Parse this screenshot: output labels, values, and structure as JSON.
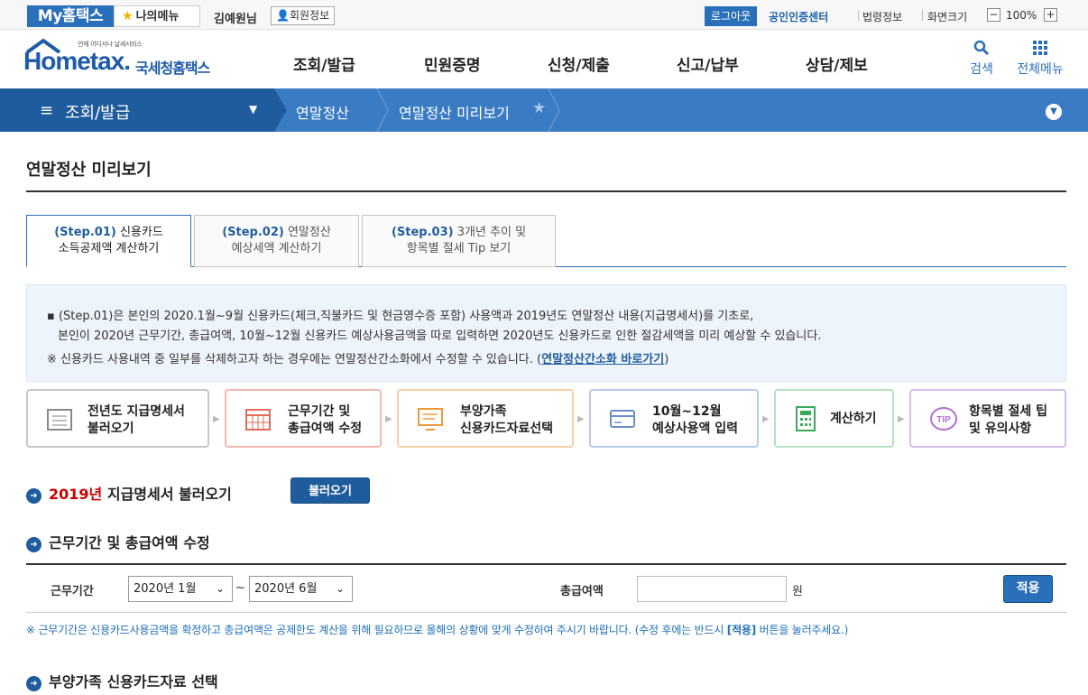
{
  "topbar": {
    "my_home": "My홈택스",
    "my_menu": "나의메뉴",
    "user_name": "김예원님",
    "member_info": "회원정보",
    "logout": "로그아웃",
    "cert_center": "공인인증센터",
    "law_info": "법령정보",
    "screen_size": "화면크기",
    "zoom": "100%"
  },
  "brand": {
    "tagline": "언제 어디서나 날세서비스",
    "word": "Hometax.",
    "sub": "국세청홈택스"
  },
  "nav": {
    "items": [
      "조회/발급",
      "민원증명",
      "신청/제출",
      "신고/납부",
      "상담/제보"
    ],
    "search": "검색",
    "all_menu": "전체메뉴"
  },
  "breadcrumb": {
    "root": "조회/발급",
    "level2": "연말정산",
    "level3": "연말정산 미리보기"
  },
  "page": {
    "title": "연말정산 미리보기"
  },
  "tabs": [
    {
      "step": "(Step.01)",
      "line1": "신용카드",
      "line2": "소득공제액 계산하기"
    },
    {
      "step": "(Step.02)",
      "line1": "연말정산",
      "line2": "예상세액 계산하기"
    },
    {
      "step": "(Step.03)",
      "line1": "3개년 추이 및",
      "line2": "항목별 절세 Tip 보기"
    }
  ],
  "notice": {
    "line1": "▪ (Step.01)은 본인의 2020.1월~9월 신용카드(체크,직불카드 및 현금영수증 포함) 사용액과 2019년도 연말정산 내용(지급명세서)를 기초로,",
    "line2": "본인이 2020년 근무기간, 총급여액, 10월~12월 신용카드 예상사용금액을 따로 입력하면 2020년도 신용카드로 인한 절감세액을 미리 예상할 수 있습니다.",
    "line3": "※ 신용카드 사용내역 중 일부를 삭제하고자 하는 경우에는 연말정산간소화에서 수정할 수 있습니다.",
    "link": "연말정산간소화 바로가기"
  },
  "flow": [
    {
      "line1": "전년도 지급명세서",
      "line2": "불러오기",
      "icon": "document-icon",
      "color": "#c8c8c8"
    },
    {
      "line1": "근무기간 및",
      "line2": "총급여액 수정",
      "icon": "calendar-icon",
      "color": "#f2b8b0"
    },
    {
      "line1": "부양가족",
      "line2": "신용카드자료선택",
      "icon": "monitor-icon",
      "color": "#f6d1a8"
    },
    {
      "line1": "10월~12월",
      "line2": "예상사용액 입력",
      "icon": "card-icon",
      "color": "#b9cbe8"
    },
    {
      "line1": "계산하기",
      "line2": "",
      "icon": "calculator-icon",
      "color": "#b8e1c2"
    },
    {
      "line1": "항목별 절세 팁",
      "line2": "및 유의사항",
      "icon": "tip-icon",
      "color": "#d8bde8"
    }
  ],
  "section1": {
    "year": "2019년",
    "title": "지급명세서 불러오기",
    "button": "불러오기"
  },
  "section2": {
    "title": "근무기간 및 총급여액 수정",
    "period_label": "근무기간",
    "start": "2020년 1월",
    "tilde": "~",
    "end": "2020년 6월",
    "salary_label": "총급여액",
    "salary_value": "",
    "unit": "원",
    "apply": "적용",
    "note_a": "※ 근무기간은 신용카드사용금액을 확정하고 총급여액은 공제한도 계산을 위해 필요하므로 올해의 상황에 맞게 수정하여 주시기 바랍니다. (수정 후에는 반드시 ",
    "note_b": "[적용]",
    "note_c": " 버튼을 눌러주세요.)"
  },
  "section3": {
    "title": "부양가족 신용카드자료 선택"
  },
  "colors": {
    "primary": "#1f5c9e",
    "accent": "#2a6fb9",
    "highlight": "#c00000"
  }
}
